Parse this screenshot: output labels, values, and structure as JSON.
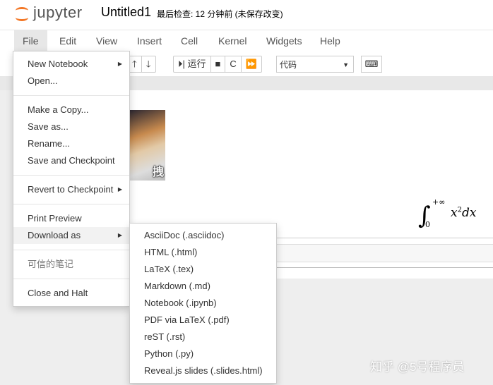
{
  "header": {
    "logo": "jupyter",
    "title": "Untitled1",
    "checkpoint": "最后检查: 12 分钟前  (未保存改变)"
  },
  "menubar": [
    "File",
    "Edit",
    "View",
    "Insert",
    "Cell",
    "Kernel",
    "Widgets",
    "Help"
  ],
  "toolbar": {
    "up": "🡑",
    "down": "🡓",
    "run": "⏵| 运行",
    "stop": "■",
    "restart": "C",
    "fastforward": "⏩",
    "cell_type": "代码",
    "keyboard": "⌨"
  },
  "cell": {
    "image_caption": "拽",
    "math": {
      "upper": "+∞",
      "lower": "0",
      "integrand": "x",
      "power": "2",
      "dx": "dx"
    }
  },
  "file_menu": {
    "items": [
      "New Notebook",
      "Open...",
      "Make a Copy...",
      "Save as...",
      "Rename...",
      "Save and Checkpoint",
      "Revert to Checkpoint",
      "Print Preview",
      "Download as",
      "可信的笔记",
      "Close and Halt"
    ]
  },
  "download_menu": [
    "AsciiDoc (.asciidoc)",
    "HTML (.html)",
    "LaTeX (.tex)",
    "Markdown (.md)",
    "Notebook (.ipynb)",
    "PDF via LaTeX (.pdf)",
    "reST (.rst)",
    "Python (.py)",
    "Reveal.js slides (.slides.html)"
  ],
  "watermark": "知乎 @5号程序员"
}
